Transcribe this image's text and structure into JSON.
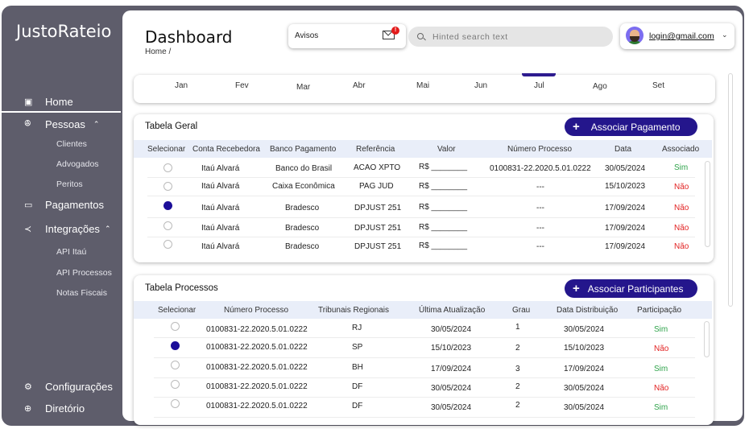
{
  "app": {
    "logo": "JustoRateio"
  },
  "sidebar": {
    "home": "Home",
    "pessoas": "Pessoas",
    "pessoas_sub": [
      "Clientes",
      "Advogados",
      "Peritos"
    ],
    "pagamentos": "Pagamentos",
    "integracoes": "Integrações",
    "integracoes_sub": [
      "API Itaú",
      "API Processos",
      "Notas Fiscais"
    ],
    "configuracoes": "Configurações",
    "diretorio": "Diretório"
  },
  "header": {
    "title": "Dashboard",
    "breadcrumb": "Home /",
    "avisos_label": "Avisos",
    "avisos_badge": "!",
    "search_placeholder": "Hinted search text",
    "user_email": "login@gmail.com"
  },
  "months": [
    "Jan",
    "Fev",
    "Mar",
    "Abr",
    "Mai",
    "Jun",
    "Jul",
    "Ago",
    "Set"
  ],
  "active_month": "Jul",
  "tabela_geral": {
    "title": "Tabela Geral",
    "button": "Associar Pagamento",
    "columns": [
      "Selecionar",
      "Conta Recebedora",
      "Banco Pagamento",
      "Referência",
      "Valor",
      "Número Processo",
      "Data",
      "Associado"
    ],
    "rows": [
      {
        "selected": false,
        "conta": "Itaú Alvará",
        "banco": "Banco do Brasil",
        "ref": "ACAO XPTO",
        "valor": "R$ ________",
        "processo": "0100831-22.2020.5.01.0222",
        "data": "30/05/2024",
        "associado": "Sim"
      },
      {
        "selected": false,
        "conta": "Itaú Alvará",
        "banco": "Caixa Econômica",
        "ref": "PAG JUD",
        "valor": "R$ ________",
        "processo": "---",
        "data": "15/10/2023",
        "associado": "Não"
      },
      {
        "selected": true,
        "conta": "Itaú Alvará",
        "banco": "Bradesco",
        "ref": "DPJUST 251",
        "valor": "R$ ________",
        "processo": "---",
        "data": "17/09/2024",
        "associado": "Não"
      },
      {
        "selected": false,
        "conta": "Itaú Alvará",
        "banco": "Bradesco",
        "ref": "DPJUST 251",
        "valor": "R$ ________",
        "processo": "---",
        "data": "17/09/2024",
        "associado": "Não"
      },
      {
        "selected": false,
        "conta": "Itaú Alvará",
        "banco": "Bradesco",
        "ref": "DPJUST 251",
        "valor": "R$ ________",
        "processo": "---",
        "data": "17/09/2024",
        "associado": "Não"
      }
    ]
  },
  "tabela_processos": {
    "title": "Tabela Processos",
    "button": "Associar Participantes",
    "columns": [
      "Selecionar",
      "Número Processo",
      "Tribunais Regionais",
      "Última Atualização",
      "Grau",
      "Data Distribuição",
      "Participação"
    ],
    "rows": [
      {
        "selected": false,
        "processo": "0100831-22.2020.5.01.0222",
        "tribunal": "RJ",
        "atualizacao": "30/05/2024",
        "grau": "1",
        "distribuicao": "30/05/2024",
        "participacao": "Sim"
      },
      {
        "selected": true,
        "processo": "0100831-22.2020.5.01.0222",
        "tribunal": "SP",
        "atualizacao": "15/10/2023",
        "grau": "2",
        "distribuicao": "15/10/2023",
        "participacao": "Não"
      },
      {
        "selected": false,
        "processo": "0100831-22.2020.5.01.0222",
        "tribunal": "BH",
        "atualizacao": "17/09/2024",
        "grau": "3",
        "distribuicao": "17/09/2024",
        "participacao": "Sim"
      },
      {
        "selected": false,
        "processo": "0100831-22.2020.5.01.0222",
        "tribunal": "DF",
        "atualizacao": "30/05/2024",
        "grau": "2",
        "distribuicao": "30/05/2024",
        "participacao": "Não"
      },
      {
        "selected": false,
        "processo": "0100831-22.2020.5.01.0222",
        "tribunal": "DF",
        "atualizacao": "30/05/2024",
        "grau": "2",
        "distribuicao": "30/05/2024",
        "participacao": "Sim"
      }
    ]
  },
  "colors": {
    "sidebar": "#5e5d6b",
    "accent": "#24168c",
    "sim": "#2ea34a",
    "nao": "#e22222",
    "table_header": "#e9eef9"
  }
}
